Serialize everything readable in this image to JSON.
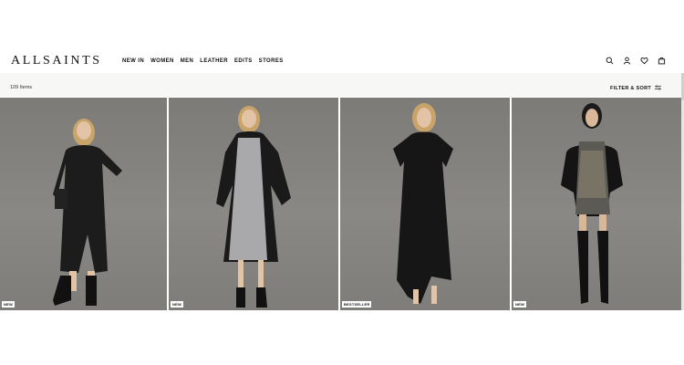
{
  "brand": {
    "logo": "ALLSAINTS"
  },
  "nav": {
    "items": [
      {
        "label": "NEW IN"
      },
      {
        "label": "WOMEN"
      },
      {
        "label": "MEN"
      },
      {
        "label": "LEATHER"
      },
      {
        "label": "EDITS"
      },
      {
        "label": "STORES"
      }
    ]
  },
  "header_icons": [
    "search-icon",
    "account-icon",
    "wishlist-heart-icon",
    "bag-icon"
  ],
  "toolbar": {
    "item_count": "109 Items",
    "filter_label": "FILTER & SORT",
    "filter_icon": "sliders-icon"
  },
  "products": [
    {
      "badge": "NEW"
    },
    {
      "badge": "NEW"
    },
    {
      "badge": "BESTSELLER"
    },
    {
      "badge": "NEW"
    }
  ],
  "colors": {
    "background": "#ffffff",
    "toolbar_bg": "#f7f7f6",
    "tile_bg": "#878582",
    "text": "#111111"
  }
}
